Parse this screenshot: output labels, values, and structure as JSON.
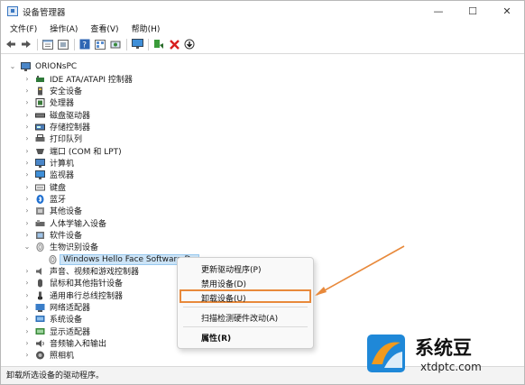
{
  "window": {
    "title": "设备管理器",
    "controls": {
      "minimize": "—",
      "maximize": "☐",
      "close": "✕"
    }
  },
  "menu": [
    "文件(F)",
    "操作(A)",
    "查看(V)",
    "帮助(H)"
  ],
  "toolbar_icons": [
    "back-icon",
    "forward-icon",
    "properties-icon",
    "hide-icon",
    "help-icon",
    "view-icon",
    "scan-icon",
    "monitor-icon",
    "enable-icon",
    "uninstall-icon",
    "update-icon"
  ],
  "tree": {
    "root": "ORIONsPC",
    "categories": [
      "IDE ATA/ATAPI 控制器",
      "安全设备",
      "处理器",
      "磁盘驱动器",
      "存储控制器",
      "打印队列",
      "端口 (COM 和 LPT)",
      "计算机",
      "监视器",
      "键盘",
      "蓝牙",
      "其他设备",
      "人体学输入设备",
      "软件设备",
      "生物识别设备",
      "声音、视频和游戏控制器",
      "鼠标和其他指针设备",
      "通用串行总线控制器",
      "网络适配器",
      "系统设备",
      "显示适配器",
      "音频输入和输出",
      "照相机"
    ],
    "selected_device": "Windows Hello Face Software De"
  },
  "context_menu": {
    "items": [
      "更新驱动程序(P)",
      "禁用设备(D)",
      "卸载设备(U)",
      "扫描检测硬件改动(A)",
      "属性(R)"
    ],
    "highlight_color": "#e8893b"
  },
  "status": "卸载所选设备的驱动程序。",
  "watermark": {
    "name": "系统豆",
    "url": "xtdptc.com"
  },
  "colors": {
    "selection": "#cce4f7",
    "accent": "#e8893b",
    "logo_blue": "#1f88d8",
    "logo_orange": "#f29a1d"
  }
}
